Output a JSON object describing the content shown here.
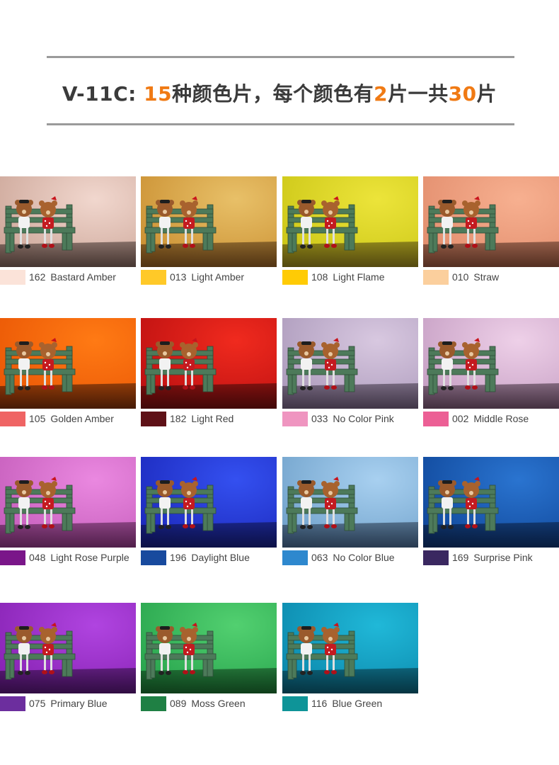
{
  "title": {
    "prefix": "V-11C: ",
    "num1": "15",
    "mid1": "种颜色片，每个颜色有",
    "num2": "2",
    "mid2": "片一共",
    "num3": "30",
    "suffix": "片"
  },
  "filters": [
    {
      "code": "162",
      "name": "Bastard Amber",
      "swatch": "#fbe3d9",
      "bg_light": "#f1d7ce",
      "bg_dark": "#c9a294",
      "floor": "#3e302c"
    },
    {
      "code": "013",
      "name": "Light Amber",
      "swatch": "#ffc928",
      "bg_light": "#e8c068",
      "bg_dark": "#c88c2e",
      "floor": "#4a2f12"
    },
    {
      "code": "108",
      "name": "Light Flame",
      "swatch": "#ffcb05",
      "bg_light": "#ece43a",
      "bg_dark": "#c9c414",
      "floor": "#4d4210"
    },
    {
      "code": "010",
      "name": "Straw",
      "swatch": "#fbcf9d",
      "bg_light": "#f7b090",
      "bg_dark": "#e08a6a",
      "floor": "#4b2a1e"
    },
    {
      "code": "105",
      "name": "Golden Amber",
      "swatch": "#ef6464",
      "bg_light": "#ff7a14",
      "bg_dark": "#e85404",
      "floor": "#3d1806"
    },
    {
      "code": "182",
      "name": "Light Red",
      "swatch": "#5e1117",
      "bg_light": "#f02a1e",
      "bg_dark": "#b80e10",
      "floor": "#3a0808"
    },
    {
      "code": "033",
      "name": "No Color Pink",
      "swatch": "#ef95c0",
      "bg_light": "#d8c8e0",
      "bg_dark": "#a896b8",
      "floor": "#3a3040"
    },
    {
      "code": "002",
      "name": "Middle Rose",
      "swatch": "#ec5f95",
      "bg_light": "#eed0e8",
      "bg_dark": "#c29ac0",
      "floor": "#3c2a38"
    },
    {
      "code": "048",
      "name": "Light Rose Purple",
      "swatch": "#7a1689",
      "bg_light": "#ea88e0",
      "bg_dark": "#c25ab8",
      "floor": "#4a1c44"
    },
    {
      "code": "196",
      "name": "Daylight Blue",
      "swatch": "#184a9e",
      "bg_light": "#3450f0",
      "bg_dark": "#1a26b8",
      "floor": "#0c1040"
    },
    {
      "code": "063",
      "name": "No Color Blue",
      "swatch": "#2e88ce",
      "bg_light": "#a8d0f0",
      "bg_dark": "#6c9ec8",
      "floor": "#243448"
    },
    {
      "code": "169",
      "name": "Surprise Pink",
      "swatch": "#3a2860",
      "bg_light": "#2a74d0",
      "bg_dark": "#0e4496",
      "floor": "#081a38"
    },
    {
      "code": "075",
      "name": "Primary Blue",
      "swatch": "#6c2e9e",
      "bg_light": "#b044e0",
      "bg_dark": "#8420b0",
      "floor": "#2c0c3c"
    },
    {
      "code": "089",
      "name": "Moss Green",
      "swatch": "#1f8044",
      "bg_light": "#52d070",
      "bg_dark": "#24a04a",
      "floor": "#0e3818"
    },
    {
      "code": "116",
      "name": "Blue Green",
      "swatch": "#0e9498",
      "bg_light": "#20b8d8",
      "bg_dark": "#0a84a8",
      "floor": "#06303c"
    }
  ]
}
